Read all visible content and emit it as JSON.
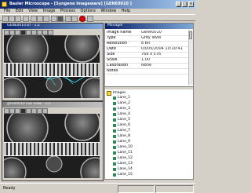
{
  "window": {
    "title": "Basler Microscope - [Syngene Imageware] [GENE0010 ]",
    "minimize": "_",
    "maximize": "□",
    "close": "×"
  },
  "menu": [
    "File",
    "Edit",
    "View",
    "Image",
    "Process",
    "Options",
    "Window",
    "Help"
  ],
  "toolbar": {
    "icons": [
      "new-icon",
      "open-icon",
      "save-icon",
      "print-icon",
      "cut-icon",
      "copy-icon",
      "paste-icon",
      "zoom-icon",
      "contrast-icon",
      "camera-icon",
      "capture-icon",
      "stop-icon",
      "help-icon"
    ]
  },
  "subwindows": [
    {
      "title": "GENE0010.tif - 1:2"
    },
    {
      "title": "gene0010 live view - 1:2"
    }
  ],
  "properties": {
    "title": "Manager",
    "rows": [
      {
        "key": "Image name",
        "value": "Gene0010"
      },
      {
        "key": "Type",
        "value": "Grey level"
      },
      {
        "key": "Resolution",
        "value": "8 bit"
      },
      {
        "key": "Date",
        "value": "03/05/2004 10:10:41"
      },
      {
        "key": "Size",
        "value": "768 x 576"
      },
      {
        "key": "Scale",
        "value": "1.00"
      },
      {
        "key": "Calibration",
        "value": "None"
      },
      {
        "key": "Notes",
        "value": ""
      }
    ]
  },
  "tree": {
    "root": "Images",
    "items": [
      "Lane_1",
      "Lane_2",
      "Lane_3",
      "Lane_4",
      "Lane_5",
      "Lane_6",
      "Lane_7",
      "Lane_8",
      "Lane_9",
      "Lane_10",
      "Lane_11",
      "Lane_12",
      "Lane_13",
      "Lane_14",
      "Lane_15"
    ]
  },
  "statusbar": {
    "text": "Ready"
  },
  "colors": {
    "title_active": "#0a246a",
    "tree_leaf": "#2e8b57",
    "record_button": "#dd0000"
  }
}
